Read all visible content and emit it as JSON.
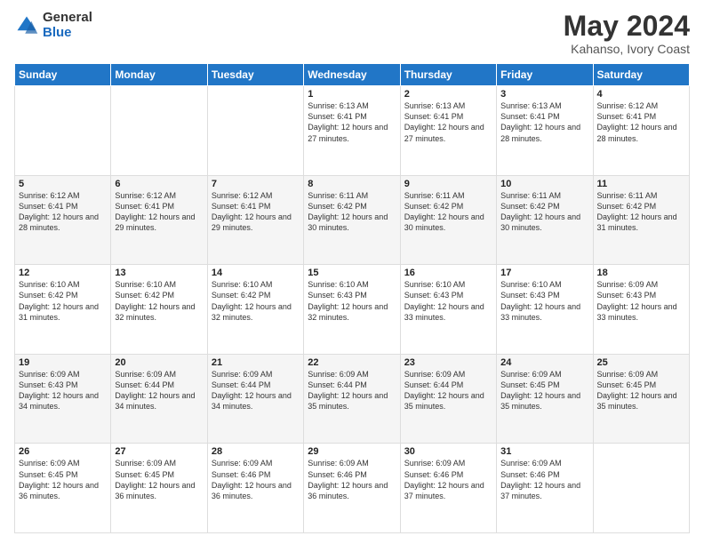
{
  "header": {
    "logo_general": "General",
    "logo_blue": "Blue",
    "month_title": "May 2024",
    "subtitle": "Kahanso, Ivory Coast"
  },
  "days_of_week": [
    "Sunday",
    "Monday",
    "Tuesday",
    "Wednesday",
    "Thursday",
    "Friday",
    "Saturday"
  ],
  "weeks": [
    [
      {
        "day": "",
        "info": ""
      },
      {
        "day": "",
        "info": ""
      },
      {
        "day": "",
        "info": ""
      },
      {
        "day": "1",
        "info": "Sunrise: 6:13 AM\nSunset: 6:41 PM\nDaylight: 12 hours and 27 minutes."
      },
      {
        "day": "2",
        "info": "Sunrise: 6:13 AM\nSunset: 6:41 PM\nDaylight: 12 hours and 27 minutes."
      },
      {
        "day": "3",
        "info": "Sunrise: 6:13 AM\nSunset: 6:41 PM\nDaylight: 12 hours and 28 minutes."
      },
      {
        "day": "4",
        "info": "Sunrise: 6:12 AM\nSunset: 6:41 PM\nDaylight: 12 hours and 28 minutes."
      }
    ],
    [
      {
        "day": "5",
        "info": "Sunrise: 6:12 AM\nSunset: 6:41 PM\nDaylight: 12 hours and 28 minutes."
      },
      {
        "day": "6",
        "info": "Sunrise: 6:12 AM\nSunset: 6:41 PM\nDaylight: 12 hours and 29 minutes."
      },
      {
        "day": "7",
        "info": "Sunrise: 6:12 AM\nSunset: 6:41 PM\nDaylight: 12 hours and 29 minutes."
      },
      {
        "day": "8",
        "info": "Sunrise: 6:11 AM\nSunset: 6:42 PM\nDaylight: 12 hours and 30 minutes."
      },
      {
        "day": "9",
        "info": "Sunrise: 6:11 AM\nSunset: 6:42 PM\nDaylight: 12 hours and 30 minutes."
      },
      {
        "day": "10",
        "info": "Sunrise: 6:11 AM\nSunset: 6:42 PM\nDaylight: 12 hours and 30 minutes."
      },
      {
        "day": "11",
        "info": "Sunrise: 6:11 AM\nSunset: 6:42 PM\nDaylight: 12 hours and 31 minutes."
      }
    ],
    [
      {
        "day": "12",
        "info": "Sunrise: 6:10 AM\nSunset: 6:42 PM\nDaylight: 12 hours and 31 minutes."
      },
      {
        "day": "13",
        "info": "Sunrise: 6:10 AM\nSunset: 6:42 PM\nDaylight: 12 hours and 32 minutes."
      },
      {
        "day": "14",
        "info": "Sunrise: 6:10 AM\nSunset: 6:42 PM\nDaylight: 12 hours and 32 minutes."
      },
      {
        "day": "15",
        "info": "Sunrise: 6:10 AM\nSunset: 6:43 PM\nDaylight: 12 hours and 32 minutes."
      },
      {
        "day": "16",
        "info": "Sunrise: 6:10 AM\nSunset: 6:43 PM\nDaylight: 12 hours and 33 minutes."
      },
      {
        "day": "17",
        "info": "Sunrise: 6:10 AM\nSunset: 6:43 PM\nDaylight: 12 hours and 33 minutes."
      },
      {
        "day": "18",
        "info": "Sunrise: 6:09 AM\nSunset: 6:43 PM\nDaylight: 12 hours and 33 minutes."
      }
    ],
    [
      {
        "day": "19",
        "info": "Sunrise: 6:09 AM\nSunset: 6:43 PM\nDaylight: 12 hours and 34 minutes."
      },
      {
        "day": "20",
        "info": "Sunrise: 6:09 AM\nSunset: 6:44 PM\nDaylight: 12 hours and 34 minutes."
      },
      {
        "day": "21",
        "info": "Sunrise: 6:09 AM\nSunset: 6:44 PM\nDaylight: 12 hours and 34 minutes."
      },
      {
        "day": "22",
        "info": "Sunrise: 6:09 AM\nSunset: 6:44 PM\nDaylight: 12 hours and 35 minutes."
      },
      {
        "day": "23",
        "info": "Sunrise: 6:09 AM\nSunset: 6:44 PM\nDaylight: 12 hours and 35 minutes."
      },
      {
        "day": "24",
        "info": "Sunrise: 6:09 AM\nSunset: 6:45 PM\nDaylight: 12 hours and 35 minutes."
      },
      {
        "day": "25",
        "info": "Sunrise: 6:09 AM\nSunset: 6:45 PM\nDaylight: 12 hours and 35 minutes."
      }
    ],
    [
      {
        "day": "26",
        "info": "Sunrise: 6:09 AM\nSunset: 6:45 PM\nDaylight: 12 hours and 36 minutes."
      },
      {
        "day": "27",
        "info": "Sunrise: 6:09 AM\nSunset: 6:45 PM\nDaylight: 12 hours and 36 minutes."
      },
      {
        "day": "28",
        "info": "Sunrise: 6:09 AM\nSunset: 6:46 PM\nDaylight: 12 hours and 36 minutes."
      },
      {
        "day": "29",
        "info": "Sunrise: 6:09 AM\nSunset: 6:46 PM\nDaylight: 12 hours and 36 minutes."
      },
      {
        "day": "30",
        "info": "Sunrise: 6:09 AM\nSunset: 6:46 PM\nDaylight: 12 hours and 37 minutes."
      },
      {
        "day": "31",
        "info": "Sunrise: 6:09 AM\nSunset: 6:46 PM\nDaylight: 12 hours and 37 minutes."
      },
      {
        "day": "",
        "info": ""
      }
    ]
  ]
}
